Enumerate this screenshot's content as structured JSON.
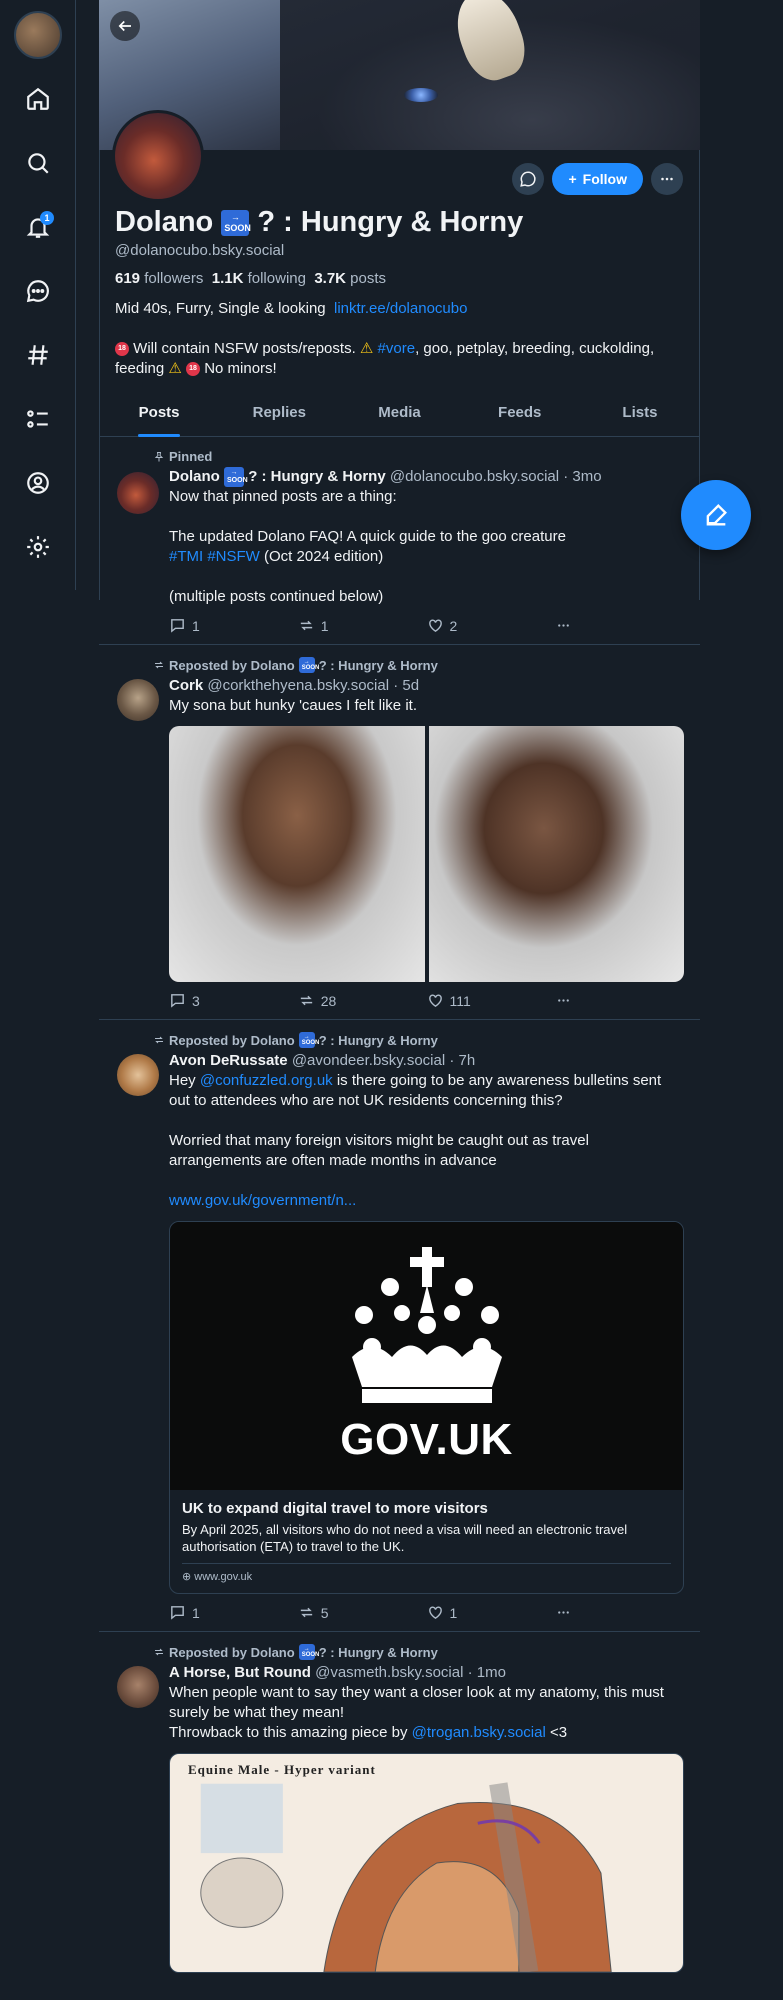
{
  "nav": {
    "notif_count": "1",
    "items": [
      "home-icon",
      "search-icon",
      "bell-icon",
      "chat-icon",
      "hashtag-icon",
      "list-icon",
      "profile-icon",
      "gear-icon"
    ]
  },
  "profile": {
    "name_part1": "Dolano",
    "soon_badge": "SOON",
    "name_part2": "? : Hungry & Horny",
    "handle": "@dolanocubo.bsky.social",
    "followers_count": "619",
    "followers_label": "followers",
    "following_count": "1.1K",
    "following_label": "following",
    "posts_count": "3.7K",
    "posts_label": "posts",
    "bio_line1": "Mid 40s, Furry, Single & looking",
    "bio_link": "linktr.ee/dolanocubo",
    "bio_line2_a": "Will contain NSFW posts/reposts.",
    "bio_tag": "#vore",
    "bio_line2_b": ", goo, petplay, breeding, cuckolding, feeding",
    "bio_line2_c": "No minors!",
    "follow_label": "Follow"
  },
  "tabs": [
    "Posts",
    "Replies",
    "Media",
    "Feeds",
    "Lists"
  ],
  "posts": [
    {
      "context": "Pinned",
      "author": "Dolano",
      "author_rest": "? : Hungry & Horny",
      "handle": "@dolanocubo.bsky.social",
      "time": "3mo",
      "text1": "Now that pinned posts are a thing:\n\nThe updated Dolano FAQ! A quick guide to the goo creature",
      "tags": "#TMI #NSFW",
      "text2": "(Oct 2024 edition)",
      "text3": "(multiple posts continued below)",
      "replies": "1",
      "reposts": "1",
      "likes": "2"
    },
    {
      "context": "Reposted by Dolano",
      "context_rest": "? : Hungry & Horny",
      "author": "Cork",
      "handle": "@corkthehyena.bsky.social",
      "time": "5d",
      "text": "My sona but hunky 'caues I felt like it.",
      "replies": "3",
      "reposts": "28",
      "likes": "111"
    },
    {
      "context": "Reposted by Dolano",
      "context_rest": "? : Hungry & Horny",
      "author": "Avon DeRussate",
      "handle": "@avondeer.bsky.social",
      "time": "7h",
      "text_a": "Hey",
      "mention": "@confuzzled.org.uk",
      "text_b": "is there going to be any awareness bulletins sent out to attendees who are not UK residents concerning this?\n\nWorried that many foreign visitors might be caught out as travel arrangements are often made months in advance",
      "url": "www.gov.uk/government/n...",
      "card_brand": "GOV.UK",
      "card_title": "UK to expand digital travel to more visitors",
      "card_desc": "By April 2025, all visitors who do not need a visa will need an electronic travel authorisation (ETA) to travel to the UK.",
      "card_domain": "www.gov.uk",
      "replies": "1",
      "reposts": "5",
      "likes": "1"
    },
    {
      "context": "Reposted by Dolano",
      "context_rest": "? : Hungry & Horny",
      "author": "A Horse, But Round",
      "handle": "@vasmeth.bsky.social",
      "time": "1mo",
      "text1": "When people want to say they want a closer look at my anatomy, this must surely be what they mean!",
      "text2": "Throwback to this amazing piece by",
      "mention": "@trogan.bsky.social",
      "text3": "<3",
      "image_title": "Equine Male - Hyper variant"
    }
  ],
  "colors": {
    "accent": "#208bfe",
    "bg": "#161e27",
    "border": "#2e4052"
  }
}
